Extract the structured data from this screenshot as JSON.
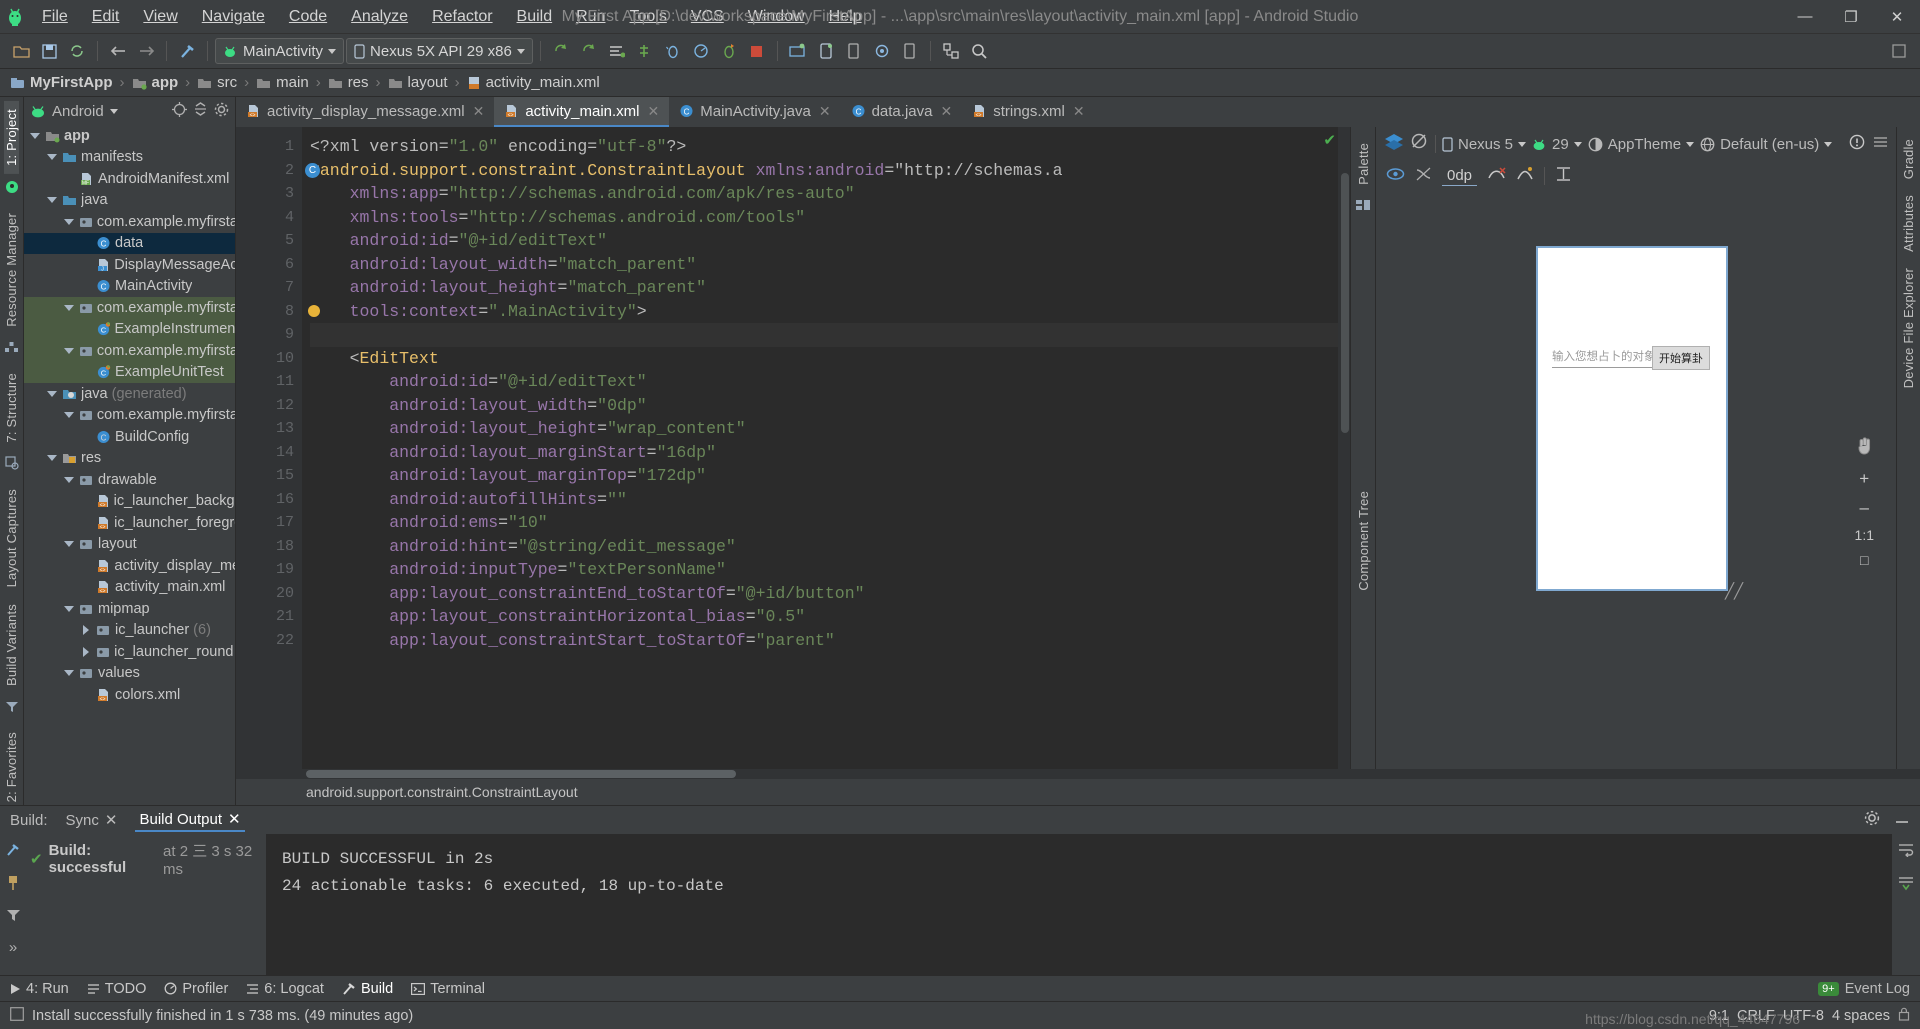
{
  "window": {
    "title": "My First App [D:\\dev\\workspace\\MyFirstApp] - ...\\app\\src\\main\\res\\layout\\activity_main.xml [app] - Android Studio",
    "minimize": "—",
    "maximize": "❐",
    "close": "✕"
  },
  "menu": [
    {
      "label": "File"
    },
    {
      "label": "Edit"
    },
    {
      "label": "View"
    },
    {
      "label": "Navigate"
    },
    {
      "label": "Code"
    },
    {
      "label": "Analyze"
    },
    {
      "label": "Refactor"
    },
    {
      "label": "Build"
    },
    {
      "label": "Run"
    },
    {
      "label": "Tools"
    },
    {
      "label": "VCS"
    },
    {
      "label": "Window"
    },
    {
      "label": "Help"
    }
  ],
  "toolbar": {
    "run_config": "MainActivity",
    "device": "Nexus 5X API 29 x86"
  },
  "breadcrumb": [
    {
      "label": "MyFirstApp",
      "bold": true
    },
    {
      "label": "app",
      "bold": true
    },
    {
      "label": "src",
      "bold": false
    },
    {
      "label": "main",
      "bold": false
    },
    {
      "label": "res",
      "bold": false
    },
    {
      "label": "layout",
      "bold": false
    },
    {
      "label": "activity_main.xml",
      "bold": false
    }
  ],
  "left_rail": [
    {
      "label": "1: Project",
      "selected": true
    },
    {
      "label": "Resource Manager",
      "selected": false
    },
    {
      "label": "7: Structure",
      "selected": false
    },
    {
      "label": "Layout Captures",
      "selected": false
    },
    {
      "label": "Build Variants",
      "selected": false
    },
    {
      "label": "2: Favorites",
      "selected": false
    }
  ],
  "right_rail": [
    {
      "label": "Gradle"
    },
    {
      "label": "Attributes"
    },
    {
      "label": "Device File Explorer"
    }
  ],
  "project": {
    "selector": "Android",
    "tree": [
      {
        "indent": 0,
        "twisty": "down",
        "icon": "folder-module",
        "label": "app",
        "bold": true,
        "state": ""
      },
      {
        "indent": 1,
        "twisty": "down",
        "icon": "folder",
        "label": "manifests",
        "bold": false,
        "state": ""
      },
      {
        "indent": 2,
        "twisty": "none",
        "icon": "file-manifest",
        "label": "AndroidManifest.xml",
        "bold": false,
        "state": ""
      },
      {
        "indent": 1,
        "twisty": "down",
        "icon": "folder",
        "label": "java",
        "bold": false,
        "state": ""
      },
      {
        "indent": 2,
        "twisty": "down",
        "icon": "package",
        "label": "com.example.myfirstap",
        "bold": false,
        "state": ""
      },
      {
        "indent": 3,
        "twisty": "none",
        "icon": "class",
        "label": "data",
        "bold": false,
        "state": "sel"
      },
      {
        "indent": 3,
        "twisty": "none",
        "icon": "file-java",
        "label": "DisplayMessageAct",
        "bold": false,
        "state": ""
      },
      {
        "indent": 3,
        "twisty": "none",
        "icon": "class",
        "label": "MainActivity",
        "bold": false,
        "state": ""
      },
      {
        "indent": 2,
        "twisty": "down",
        "icon": "package",
        "label": "com.example.myfirstap",
        "bold": false,
        "state": "green"
      },
      {
        "indent": 3,
        "twisty": "none",
        "icon": "class-test",
        "label": "ExampleInstrument",
        "bold": false,
        "state": "green"
      },
      {
        "indent": 2,
        "twisty": "down",
        "icon": "package",
        "label": "com.example.myfirstap",
        "bold": false,
        "state": "green"
      },
      {
        "indent": 3,
        "twisty": "none",
        "icon": "class-test",
        "label": "ExampleUnitTest",
        "bold": false,
        "state": "green"
      },
      {
        "indent": 1,
        "twisty": "down",
        "icon": "folder-gen",
        "label": "java",
        "suffix": "(generated)",
        "bold": false,
        "state": ""
      },
      {
        "indent": 2,
        "twisty": "down",
        "icon": "package",
        "label": "com.example.myfirstap",
        "bold": false,
        "state": ""
      },
      {
        "indent": 3,
        "twisty": "none",
        "icon": "class-gen",
        "label": "BuildConfig",
        "bold": false,
        "state": ""
      },
      {
        "indent": 1,
        "twisty": "down",
        "icon": "folder-res",
        "label": "res",
        "bold": false,
        "state": ""
      },
      {
        "indent": 2,
        "twisty": "down",
        "icon": "package",
        "label": "drawable",
        "bold": false,
        "state": ""
      },
      {
        "indent": 3,
        "twisty": "none",
        "icon": "file-xml",
        "label": "ic_launcher_backgro",
        "bold": false,
        "state": ""
      },
      {
        "indent": 3,
        "twisty": "none",
        "icon": "file-xml",
        "label": "ic_launcher_foregro",
        "bold": false,
        "state": ""
      },
      {
        "indent": 2,
        "twisty": "down",
        "icon": "package",
        "label": "layout",
        "bold": false,
        "state": ""
      },
      {
        "indent": 3,
        "twisty": "none",
        "icon": "file-xml",
        "label": "activity_display_me",
        "bold": false,
        "state": ""
      },
      {
        "indent": 3,
        "twisty": "none",
        "icon": "file-xml",
        "label": "activity_main.xml",
        "bold": false,
        "state": ""
      },
      {
        "indent": 2,
        "twisty": "down",
        "icon": "package",
        "label": "mipmap",
        "bold": false,
        "state": ""
      },
      {
        "indent": 3,
        "twisty": "right",
        "icon": "package",
        "label": "ic_launcher",
        "suffix": "(6)",
        "bold": false,
        "state": ""
      },
      {
        "indent": 3,
        "twisty": "right",
        "icon": "package",
        "label": "ic_launcher_round (",
        "bold": false,
        "state": ""
      },
      {
        "indent": 2,
        "twisty": "down",
        "icon": "package",
        "label": "values",
        "bold": false,
        "state": ""
      },
      {
        "indent": 3,
        "twisty": "none",
        "icon": "file-xml",
        "label": "colors.xml",
        "bold": false,
        "state": ""
      }
    ]
  },
  "tabs": [
    {
      "label": "activity_display_message.xml",
      "icon": "file-xml",
      "active": false
    },
    {
      "label": "activity_main.xml",
      "icon": "file-xml",
      "active": true
    },
    {
      "label": "MainActivity.java",
      "icon": "class",
      "active": false
    },
    {
      "label": "data.java",
      "icon": "class",
      "active": false
    },
    {
      "label": "strings.xml",
      "icon": "file-xml",
      "active": false
    }
  ],
  "editor": {
    "first_line": 1,
    "lines": [
      {
        "n": 1,
        "indent": 0,
        "html": "prolog"
      },
      {
        "n": 2,
        "indent": 0,
        "html": "root"
      },
      {
        "n": 3,
        "indent": 1,
        "html": "app_ns"
      },
      {
        "n": 4,
        "indent": 1,
        "html": "tools_ns"
      },
      {
        "n": 5,
        "indent": 1,
        "html": "id"
      },
      {
        "n": 6,
        "indent": 1,
        "html": "width"
      },
      {
        "n": 7,
        "indent": 1,
        "html": "height"
      },
      {
        "n": 8,
        "indent": 1,
        "html": "context"
      },
      {
        "n": 9,
        "indent": 0,
        "html": "blank"
      },
      {
        "n": 10,
        "indent": 1,
        "html": "edittext"
      },
      {
        "n": 11,
        "indent": 2,
        "html": "et_id"
      },
      {
        "n": 12,
        "indent": 2,
        "html": "et_w"
      },
      {
        "n": 13,
        "indent": 2,
        "html": "et_h"
      },
      {
        "n": 14,
        "indent": 2,
        "html": "et_ms"
      },
      {
        "n": 15,
        "indent": 2,
        "html": "et_mt"
      },
      {
        "n": 16,
        "indent": 2,
        "html": "et_af"
      },
      {
        "n": 17,
        "indent": 2,
        "html": "et_ems"
      },
      {
        "n": 18,
        "indent": 2,
        "html": "et_hint"
      },
      {
        "n": 19,
        "indent": 2,
        "html": "et_input"
      },
      {
        "n": 20,
        "indent": 2,
        "html": "et_end"
      },
      {
        "n": 21,
        "indent": 2,
        "html": "et_bias"
      },
      {
        "n": 22,
        "indent": 2,
        "html": "et_start"
      }
    ],
    "code_text": [
      "<?xml version=\"1.0\" encoding=\"utf-8\"?>",
      "<android.support.constraint.ConstraintLayout xmlns:android=\"http://schemas.a",
      "    xmlns:app=\"http://schemas.android.com/apk/res-auto\"",
      "    xmlns:tools=\"http://schemas.android.com/tools\"",
      "    android:id=\"@+id/editText\"",
      "    android:layout_width=\"match_parent\"",
      "    android:layout_height=\"match_parent\"",
      "    tools:context=\".MainActivity\">",
      "",
      "    <EditText",
      "        android:id=\"@+id/editText\"",
      "        android:layout_width=\"0dp\"",
      "        android:layout_height=\"wrap_content\"",
      "        android:layout_marginStart=\"16dp\"",
      "        android:layout_marginTop=\"172dp\"",
      "        android:autofillHints=\"\"",
      "        android:ems=\"10\"",
      "        android:hint=\"@string/edit_message\"",
      "        android:inputType=\"textPersonName\"",
      "        app:layout_constraintEnd_toStartOf=\"@+id/button\"",
      "        app:layout_constraintHorizontal_bias=\"0.5\"",
      "        app:layout_constraintStart_toStartOf=\"parent\""
    ],
    "status_path": "android.support.constraint.ConstraintLayout"
  },
  "palette_label": "Palette",
  "component_tree_label": "Component Tree",
  "design": {
    "device": "Nexus 5",
    "api": "29",
    "theme": "AppTheme",
    "locale": "Default (en-us)",
    "margin_value": "0dp",
    "preview": {
      "hint": "输入您想占卜的对象",
      "button": "开始算卦"
    },
    "zoom": {
      "plus": "+",
      "minus": "–",
      "ratio": "1:1",
      "fit": "□"
    }
  },
  "build": {
    "label": "Build:",
    "tabs": [
      {
        "label": "Sync",
        "active": false,
        "closable": true
      },
      {
        "label": "Build Output",
        "active": true,
        "closable": true
      }
    ],
    "tree_status": "Build: successful",
    "tree_time": "at 2 三 3 s 32 ms",
    "output": [
      "BUILD SUCCESSFUL in 2s",
      "24 actionable tasks: 6 executed, 18 up-to-date"
    ]
  },
  "bottom_tools": [
    {
      "label": "4: Run",
      "icon": "run-icon",
      "active": false
    },
    {
      "label": "TODO",
      "icon": "todo-icon",
      "active": false
    },
    {
      "label": "Profiler",
      "icon": "profiler-icon",
      "active": false
    },
    {
      "label": "6: Logcat",
      "icon": "logcat-icon",
      "active": false
    },
    {
      "label": "Build",
      "icon": "build-icon",
      "active": true
    },
    {
      "label": "Terminal",
      "icon": "terminal-icon",
      "active": false
    }
  ],
  "event_log": {
    "label": "Event Log",
    "count": "9+"
  },
  "status": {
    "message": "Install successfully finished in 1 s 738 ms. (49 minutes ago)",
    "caret": "9:1",
    "encoding": "UTF-8",
    "indent": "4 spaces",
    "watermark": "https://blog.csdn.net/qq_44647796"
  }
}
